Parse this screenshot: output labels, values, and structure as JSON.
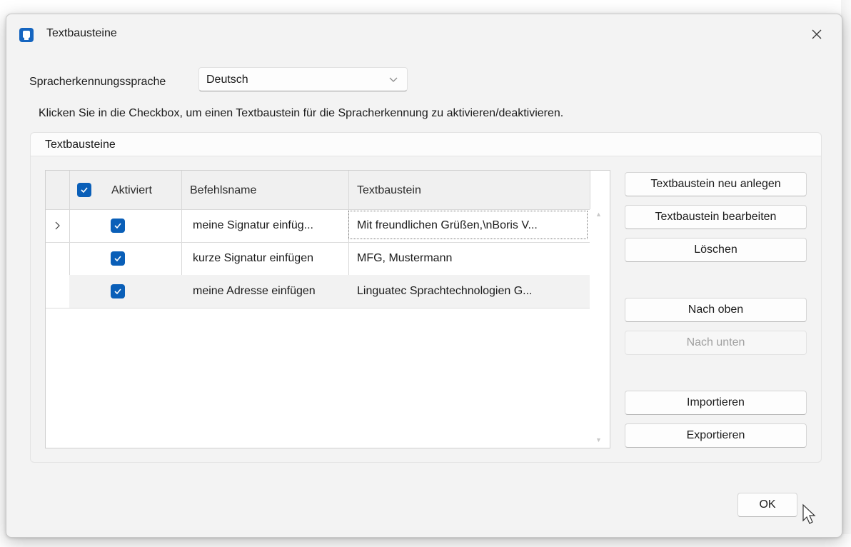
{
  "window": {
    "title": "Textbausteine"
  },
  "language": {
    "label": "Spracherkennungssprache",
    "selected": "Deutsch"
  },
  "hint": "Klicken Sie in die Checkbox, um einen Textbaustein für die Spracherkennung zu aktivieren/deaktivieren.",
  "group": {
    "title": "Textbausteine"
  },
  "grid": {
    "columns": [
      "Aktiviert",
      "Befehlsname",
      "Textbaustein"
    ],
    "rows": [
      {
        "name": "meine Signatur einfüg...",
        "text": "Mit freundlichen Grüßen,\\nBoris V...",
        "checked": true,
        "current_row_marker": "›"
      },
      {
        "name": "kurze Signatur einfügen",
        "text": "MFG, Mustermann",
        "checked": true
      },
      {
        "name": "meine Adresse einfügen",
        "text": "Linguatec Sprachtechnologien G...",
        "checked": true
      }
    ]
  },
  "buttons": {
    "new": "Textbaustein neu anlegen",
    "edit": "Textbaustein bearbeiten",
    "delete": "Löschen",
    "up": "Nach oben",
    "down": "Nach unten",
    "import": "Importieren",
    "export": "Exportieren",
    "ok": "OK"
  },
  "colors": {
    "accent": "#0a5fb8",
    "dialog_bg": "#f3f3f3"
  },
  "icons": {
    "app": "app-icon",
    "close": "close-icon",
    "chevron": "chevron-down-icon",
    "check": "check-icon"
  }
}
